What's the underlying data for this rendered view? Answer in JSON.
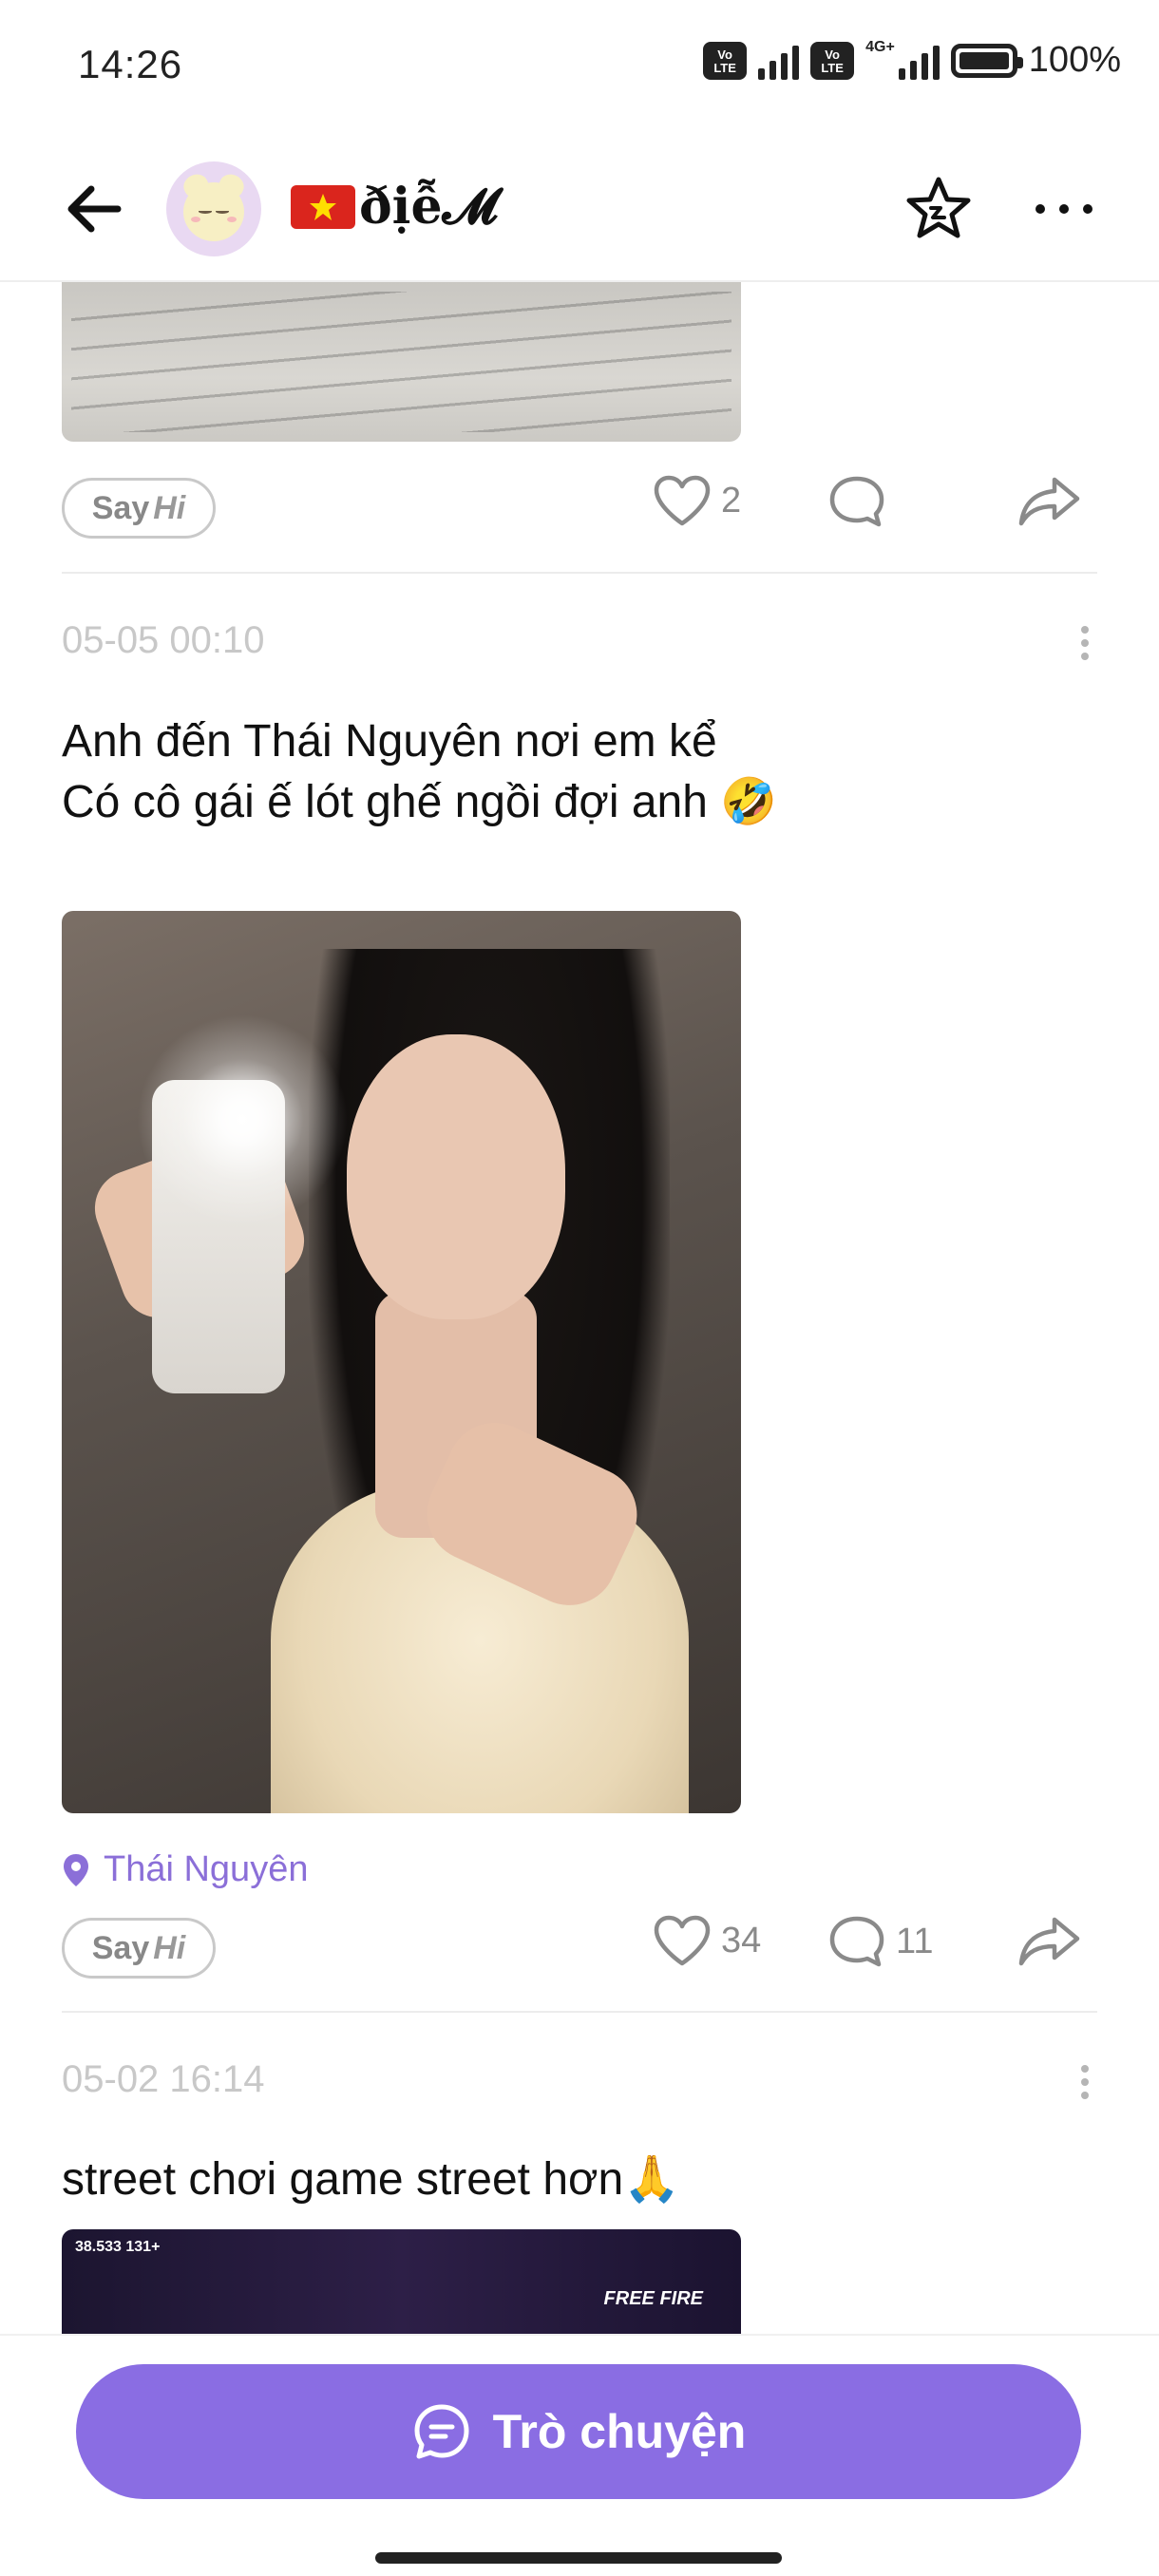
{
  "status_bar": {
    "time": "14:26",
    "volte1": "Vo LTE",
    "volte2": "Vo LTE",
    "network": "4G+",
    "battery": "100%"
  },
  "header": {
    "username": "ðịễ𝓜",
    "flag": "vietnam-flag"
  },
  "posts": [
    {
      "likes": "2",
      "comments": "",
      "say_hi_prefix": "Say",
      "say_hi_suffix": "Hi"
    },
    {
      "date": "05-05 00:10",
      "text_line1": "Anh đến Thái Nguyên nơi em kể",
      "text_line2": "Có cô gái ế lót ghế ngồi đợi anh 🤣",
      "location": "Thái Nguyên",
      "likes": "34",
      "comments": "11",
      "say_hi_prefix": "Say",
      "say_hi_suffix": "Hi"
    },
    {
      "date": "05-02 16:14",
      "text": "street chơi game street hơn🙏",
      "game_hud": "38.533   131+",
      "game_logo": "FREE FIRE"
    }
  ],
  "bottom": {
    "chat_label": "Trò chuyện"
  },
  "colors": {
    "accent": "#8a6de3",
    "location": "#8b6fd8",
    "muted": "#8a8a8a"
  }
}
